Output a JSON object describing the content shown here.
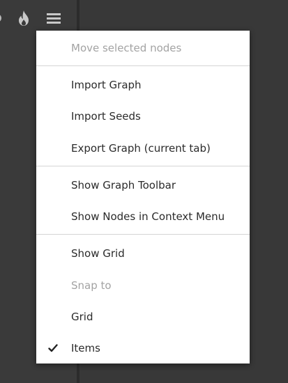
{
  "toolbar": {
    "icons": [
      "partial-icon",
      "flame-icon",
      "hamburger-menu-icon"
    ]
  },
  "context_menu": {
    "items": [
      {
        "label": "Move selected nodes",
        "disabled": true
      },
      {
        "label": "Import Graph",
        "disabled": false
      },
      {
        "label": "Import Seeds",
        "disabled": false
      },
      {
        "label": "Export Graph (current tab)",
        "disabled": false
      },
      {
        "label": "Show Graph Toolbar",
        "disabled": false
      },
      {
        "label": "Show Nodes in Context Menu",
        "disabled": false
      },
      {
        "label": "Show Grid",
        "disabled": false
      },
      {
        "label": "Snap to",
        "disabled": true
      },
      {
        "label": "Grid",
        "disabled": false
      },
      {
        "label": "Items",
        "disabled": false,
        "checked": true
      }
    ]
  },
  "colors": {
    "background": "#3a3a3a",
    "menu_background": "#ffffff",
    "text": "#2b2b2b",
    "disabled_text": "#a3a3a3",
    "separator": "#d4d4d4",
    "icon": "#c8c8c8"
  }
}
